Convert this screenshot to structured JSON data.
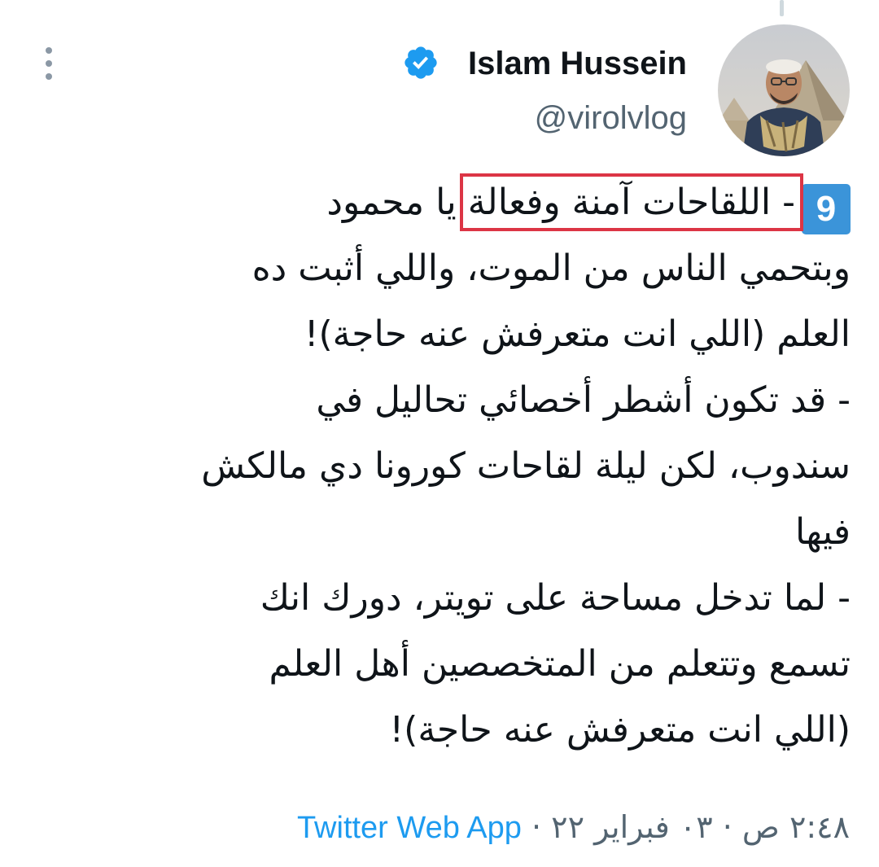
{
  "author": {
    "display_name": "Islam Hussein",
    "handle": "@virolvlog",
    "verified": true
  },
  "tweet": {
    "thread_index": "9",
    "highlighted_text": "- اللقاحات آمنة وفعالة",
    "line1_rest": " يا محمود",
    "lines": [
      "وبتحمي الناس من الموت، واللي أثبت ده",
      "العلم (اللي انت متعرفش عنه حاجة)!",
      "- قد تكون أشطر أخصائي تحاليل في",
      "سندوب، لكن ليلة لقاحات كورونا دي مالكش",
      "فيها",
      "- لما تدخل مساحة على تويتر، دورك انك",
      "تسمع وتتعلم من المتخصصين أهل العلم",
      "(اللي انت متعرفش عنه حاجة)!"
    ]
  },
  "meta": {
    "timestamp": "٢:٤٨ ص · ٠٣ فبراير ٢٢",
    "separator": " · ",
    "source": "Twitter Web App"
  },
  "colors": {
    "accent": "#1d9bf0",
    "badge": "#3b94d9",
    "highlight_box": "#dc3545",
    "secondary_text": "#536471"
  },
  "icons": {
    "verified": "verified-badge-icon",
    "more": "more-options-icon"
  }
}
